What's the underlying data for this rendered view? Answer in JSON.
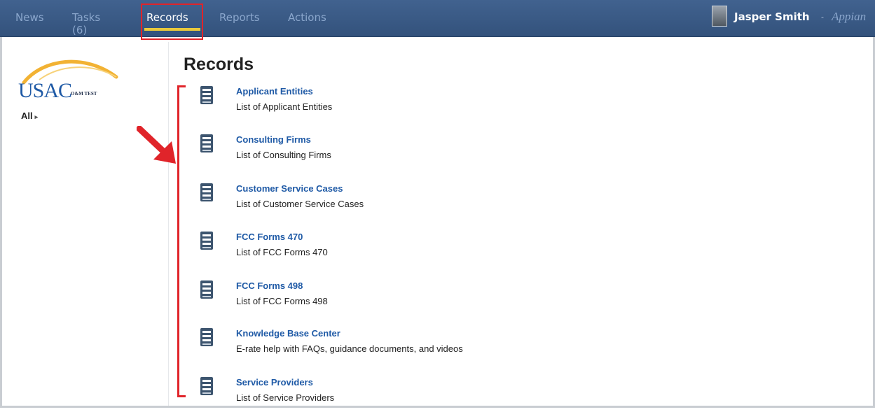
{
  "nav": {
    "items": [
      {
        "label": "News"
      },
      {
        "label": "Tasks (6)"
      },
      {
        "label": "Records"
      },
      {
        "label": "Reports"
      },
      {
        "label": "Actions"
      }
    ],
    "active": "Records"
  },
  "user": {
    "name": "Jasper Smith",
    "caret": "-",
    "brand": "Appian"
  },
  "sidebar": {
    "logo_text": "USAC",
    "logo_sub": "O&M TEST",
    "filter_label": "All"
  },
  "main": {
    "title": "Records",
    "records": [
      {
        "title": "Applicant Entities",
        "description": "List of Applicant Entities"
      },
      {
        "title": "Consulting Firms",
        "description": "List of Consulting Firms"
      },
      {
        "title": "Customer Service Cases",
        "description": "List of Customer Service Cases"
      },
      {
        "title": "FCC Forms 470",
        "description": "List of FCC Forms 470"
      },
      {
        "title": "FCC Forms 498",
        "description": "List of FCC Forms 498"
      },
      {
        "title": "Knowledge Base Center",
        "description": "E-rate help with FAQs, guidance documents, and videos"
      },
      {
        "title": "Service Providers",
        "description": "List of Service Providers"
      }
    ]
  },
  "colors": {
    "header_bg": "#3a5a86",
    "link": "#1f5aa6",
    "annotation": "#e0242a",
    "active_underline": "#e9c93c"
  }
}
